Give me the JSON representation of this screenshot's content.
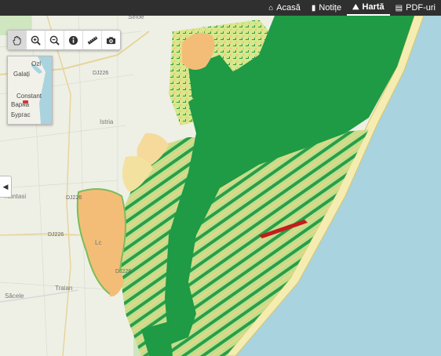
{
  "nav": {
    "items": [
      {
        "label": "Acasă",
        "icon": "home-icon",
        "active": false
      },
      {
        "label": "Notițe",
        "icon": "note-icon",
        "active": false
      },
      {
        "label": "Hartă",
        "icon": "map-icon",
        "active": true
      },
      {
        "label": "PDF-uri",
        "icon": "pdf-file-icon",
        "active": false
      }
    ]
  },
  "toolbar": {
    "tools": [
      {
        "name": "pan-tool",
        "icon": "hand-icon",
        "active": true
      },
      {
        "name": "zoom-in-tool",
        "icon": "zoom-in-icon"
      },
      {
        "name": "zoom-out-tool",
        "icon": "zoom-out-icon"
      },
      {
        "name": "info-tool",
        "icon": "info-icon"
      },
      {
        "name": "measure-tool",
        "icon": "ruler-icon"
      },
      {
        "name": "screenshot-tool",
        "icon": "camera-icon"
      }
    ]
  },
  "minimap": {
    "labels": {
      "ozl": "Ozl",
      "galati": "Galați",
      "constant": "Constant",
      "varna": "Варна",
      "burgas": "Бургас"
    }
  },
  "map": {
    "towns": {
      "sinoe": "Sinoe",
      "istria": "Istria",
      "nuntasi": "Nuntasi",
      "sacele": "Săcele",
      "traian": "Traian",
      "lc": "Lc"
    },
    "roads": {
      "dj226a": "DJ226",
      "dj226b": "DJ226",
      "dj226c": "DJ226",
      "dj226d": "DJ226"
    }
  },
  "colors": {
    "water": "#a9d3de",
    "lagoon_dark_green": "#1f9a45",
    "vegetation_light": "#d9ea8f",
    "sand_orange": "#f3bd78",
    "eroded_red": "#c21d1d",
    "navbar": "#2f2f2f"
  }
}
